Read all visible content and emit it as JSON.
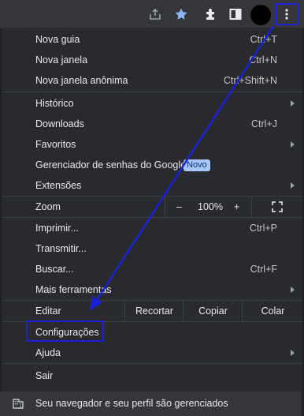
{
  "toolbar": {
    "icons": [
      "share-icon",
      "star-icon",
      "extensions-icon",
      "side-panel-icon",
      "avatar",
      "menu-icon"
    ],
    "star_color": "#8ab4f8"
  },
  "menu": {
    "new_tab": {
      "label": "Nova guia",
      "shortcut": "Ctrl+T"
    },
    "new_window": {
      "label": "Nova janela",
      "shortcut": "Ctrl+N"
    },
    "incognito": {
      "label": "Nova janela anônima",
      "shortcut": "Ctrl+Shift+N"
    },
    "history": {
      "label": "Histórico"
    },
    "downloads": {
      "label": "Downloads",
      "shortcut": "Ctrl+J"
    },
    "bookmarks": {
      "label": "Favoritos"
    },
    "passwords": {
      "label": "Gerenciador de senhas do Google",
      "badge": "Novo"
    },
    "extensions": {
      "label": "Extensões"
    },
    "zoom": {
      "label": "Zoom",
      "minus": "–",
      "value": "100%",
      "plus": "+"
    },
    "print": {
      "label": "Imprimir...",
      "shortcut": "Ctrl+P"
    },
    "cast": {
      "label": "Transmitir..."
    },
    "find": {
      "label": "Buscar...",
      "shortcut": "Ctrl+F"
    },
    "more_tools": {
      "label": "Mais ferramentas"
    },
    "edit": {
      "label": "Editar",
      "cut": "Recortar",
      "copy": "Copiar",
      "paste": "Colar"
    },
    "settings": {
      "label": "Configurações"
    },
    "help": {
      "label": "Ajuda"
    },
    "exit": {
      "label": "Sair"
    },
    "managed": {
      "label": "Seu navegador e seu perfil são gerenciados"
    }
  },
  "annotation_color": "#1a22d6"
}
